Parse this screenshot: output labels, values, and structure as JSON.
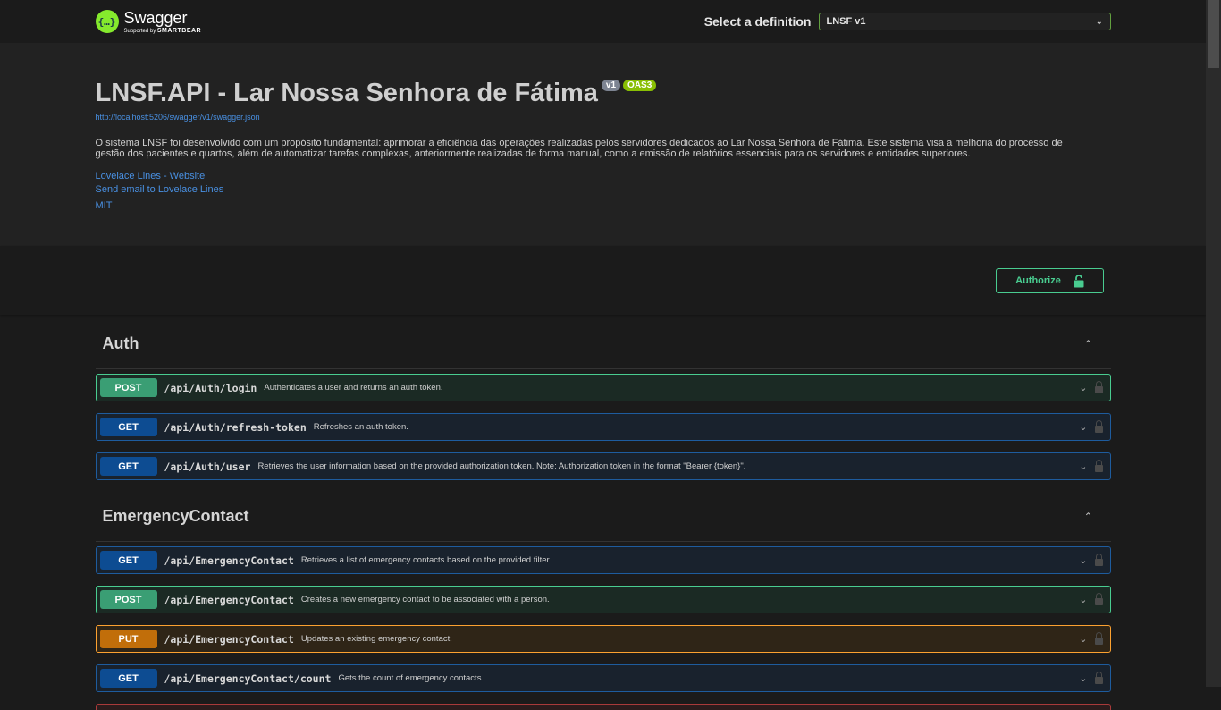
{
  "topbar": {
    "logo_name": "Swagger",
    "logo_sub_prefix": "Supported by",
    "logo_sub_brand": "SMARTBEAR",
    "select_label": "Select a definition",
    "select_value": "LNSF v1"
  },
  "info": {
    "title": "LNSF.API - Lar Nossa Senhora de Fátima",
    "version_badge": "v1",
    "oas_badge": "OAS3",
    "spec_url": "http://localhost:5206/swagger/v1/swagger.json",
    "description": "O sistema LNSF foi desenvolvido com um propósito fundamental: aprimorar a eficiência das operações realizadas pelos servidores dedicados ao Lar Nossa Senhora de Fátima. Este sistema visa a melhoria do processo de gestão dos pacientes e quartos, além de automatizar tarefas complexas, anteriormente realizadas de forma manual, como a emissão de relatórios essenciais para os servidores e entidades superiores.",
    "website_link": "Lovelace Lines - Website",
    "email_link": "Send email to Lovelace Lines",
    "license": "MIT"
  },
  "scheme": {
    "authorize_label": "Authorize"
  },
  "tags": [
    {
      "name": "Auth",
      "operations": [
        {
          "method": "POST",
          "path": "/api/Auth/login",
          "summary": "Authenticates a user and returns an auth token."
        },
        {
          "method": "GET",
          "path": "/api/Auth/refresh-token",
          "summary": "Refreshes an auth token."
        },
        {
          "method": "GET",
          "path": "/api/Auth/user",
          "summary": "Retrieves the user information based on the provided authorization token. Note: Authorization token in the format \"Bearer {token}\"."
        }
      ]
    },
    {
      "name": "EmergencyContact",
      "operations": [
        {
          "method": "GET",
          "path": "/api/EmergencyContact",
          "summary": "Retrieves a list of emergency contacts based on the provided filter."
        },
        {
          "method": "POST",
          "path": "/api/EmergencyContact",
          "summary": "Creates a new emergency contact to be associated with a person."
        },
        {
          "method": "PUT",
          "path": "/api/EmergencyContact",
          "summary": "Updates an existing emergency contact."
        },
        {
          "method": "GET",
          "path": "/api/EmergencyContact/count",
          "summary": "Gets the count of emergency contacts."
        }
      ]
    }
  ],
  "colors": {
    "post": "#49cc90",
    "get": "#0d4c92",
    "put": "#fca130",
    "link": "#4990e2",
    "brand": "#85ea2d"
  },
  "icons": {
    "logo": "swagger-logo-icon",
    "select_chevron": "chevron-down-icon",
    "authorize_lock": "unlocked-padlock-icon",
    "tag_collapse": "chevron-up-icon",
    "op_expand": "chevron-down-icon",
    "op_lock": "padlock-icon"
  }
}
